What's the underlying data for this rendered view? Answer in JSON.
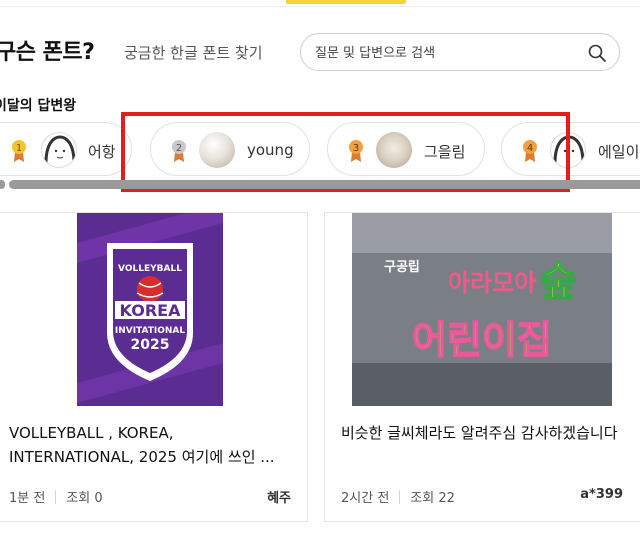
{
  "header": {
    "title": "구슨 폰트?",
    "subtitle": "궁금한 한글 폰트 찾기"
  },
  "search": {
    "placeholder": "질문 및 답변으로 검색",
    "icon": "search-icon"
  },
  "ranking": {
    "label": "이달의 답변왕",
    "users": [
      {
        "rank": "1",
        "name": "어항",
        "medal_color": "#f4c430"
      },
      {
        "rank": "2",
        "name": "young",
        "medal_color": "#c9c9c9"
      },
      {
        "rank": "3",
        "name": "그을림",
        "medal_color": "#f0a040"
      },
      {
        "rank": "4",
        "name": "에일이",
        "medal_color": "#f0a040"
      }
    ]
  },
  "posts": [
    {
      "image_text": [
        "VOLLEYBALL",
        "KOREA",
        "INVITATIONAL",
        "2025"
      ],
      "text": "VOLLEYBALL , KOREA, INTERNATIONAL, 2025 여기에 쓰인 ...",
      "time": "1분 전",
      "views": "조회 0",
      "author": "혜주"
    },
    {
      "image_text": [
        "구공립",
        "아라모아",
        "숲",
        "어린이집"
      ],
      "text": "비슷한 글씨체라도 알려주심 감사하겠습니다",
      "time": "2시간 전",
      "views": "조회 22",
      "author": "a*399"
    }
  ],
  "colors": {
    "accent": "#f7d23e",
    "highlight": "#e51c1c"
  }
}
